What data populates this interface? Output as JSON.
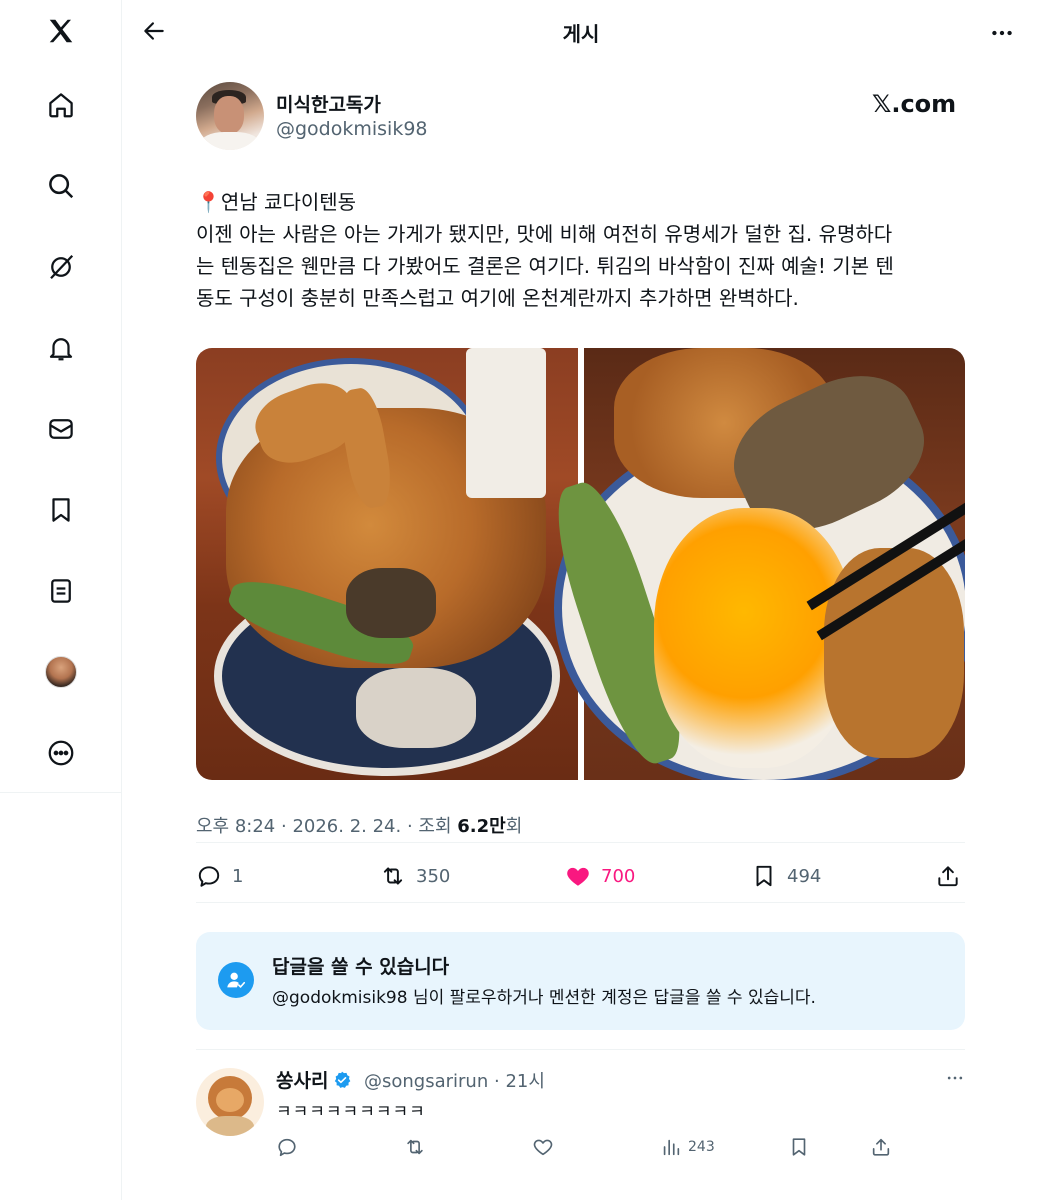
{
  "header": {
    "title": "게시"
  },
  "post": {
    "author_name": "미식한고독가",
    "author_handle": "@godokmisik98",
    "watermark": "𝕏.com",
    "text_lines": [
      "📍연남 쿄다이텐동",
      "이젠 아는 사람은 아는 가게가 됐지만, 맛에 비해 여전히 유명세가 덜한 집. 유명하다",
      "는 텐동집은 웬만큼 다 가봤어도 결론은 여기다. 튀김의 바삭함이 진짜 예술! 기본 텐",
      "동도 구성이 충분히 만족스럽고 여기에 온천계란까지 추가하면 완벽하다."
    ],
    "meta": {
      "time": "오후 8:24",
      "date": "2026. 2. 24.",
      "views_label": "조회",
      "views_value": "6.2만",
      "views_suffix": "회",
      "sep": "·"
    },
    "actions": {
      "replies": "1",
      "retweets": "350",
      "likes": "700",
      "bookmarks": "494"
    }
  },
  "reply_notice": {
    "title": "답글을 쓸 수 있습니다",
    "description": "@godokmisik98 님이 팔로우하거나 멘션한 계정은 답글을 쓸 수 있습니다."
  },
  "reply": {
    "name": "쏭사리",
    "handle": "@songsarirun",
    "time": "21시",
    "sep": "·",
    "text": "ㅋㅋㅋㅋㅋㅋㅋㅋㅋ",
    "views": "243"
  },
  "icons": {
    "nav": [
      "x-logo-icon",
      "home-icon",
      "search-icon",
      "grok-icon",
      "notifications-icon",
      "messages-icon",
      "bookmarks-icon",
      "lists-icon",
      "profile-avatar",
      "more-circle-icon"
    ]
  },
  "colors": {
    "accent": "#1d9bf0",
    "like": "#f91880",
    "muted": "#536471",
    "notice_bg": "#e8f5fd"
  }
}
